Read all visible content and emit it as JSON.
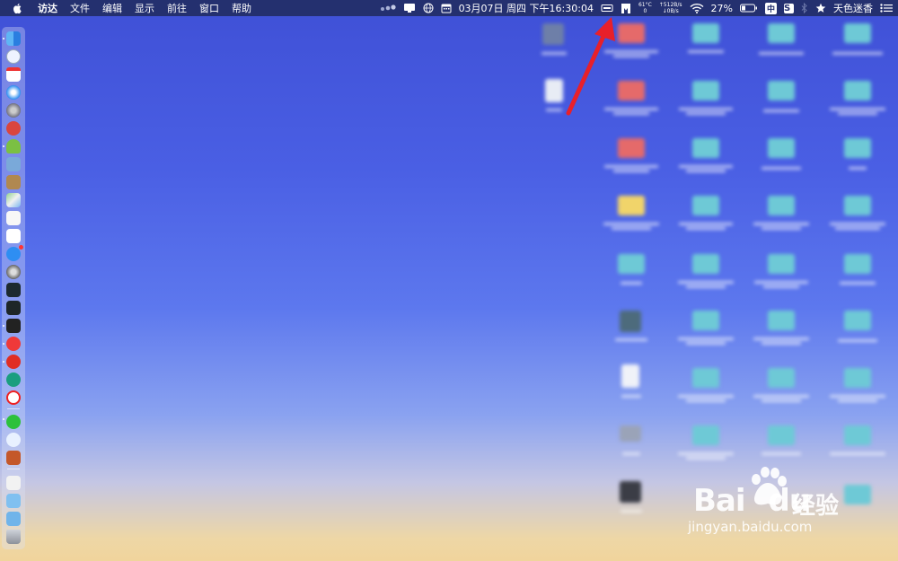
{
  "menubar": {
    "app_name": "访达",
    "menus": [
      "文件",
      "编辑",
      "显示",
      "前往",
      "窗口",
      "帮助"
    ],
    "datetime": "03月07日 周四 下午16:30:04",
    "temperature_top": "61°C",
    "temperature_bottom": "0",
    "net_up": "↑512B/s",
    "net_down": "↓0B/s",
    "battery": "27%",
    "ime": "中",
    "s_icon": "S",
    "user_name": "天色迷香",
    "icons": [
      "apple-icon",
      "control-dots-icon",
      "display-icon",
      "globe-icon",
      "calendar-icon",
      "battery-card-icon",
      "bookmark-icon",
      "wifi-icon",
      "battery-icon",
      "ime-icon",
      "s-app-icon",
      "bluetooth-icon",
      "star-icon",
      "list-icon"
    ]
  },
  "dock": {
    "apps": [
      "finder",
      "safari-alt",
      "calendar",
      "safari",
      "launchpad",
      "music-app",
      "android",
      "preview",
      "notes",
      "maps",
      "textedit",
      "reminders",
      "app-store",
      "system-preferences",
      "activity-monitor",
      "terminal-1",
      "terminal-2",
      "vivaldi",
      "netease-music",
      "gitkraken",
      "yandex",
      "wechat",
      "baidu-netdisk",
      "toolbox",
      "document",
      "folder-1",
      "folder-2",
      "trash"
    ]
  },
  "watermark": {
    "logo_text": "Bai",
    "logo_text2": "du",
    "cn_text": "经验",
    "url": "jingyan.baidu.com"
  },
  "colors": {
    "menubar_bg": "#24306f",
    "arrow": "#e8202a",
    "accent": "#3f50d6"
  }
}
